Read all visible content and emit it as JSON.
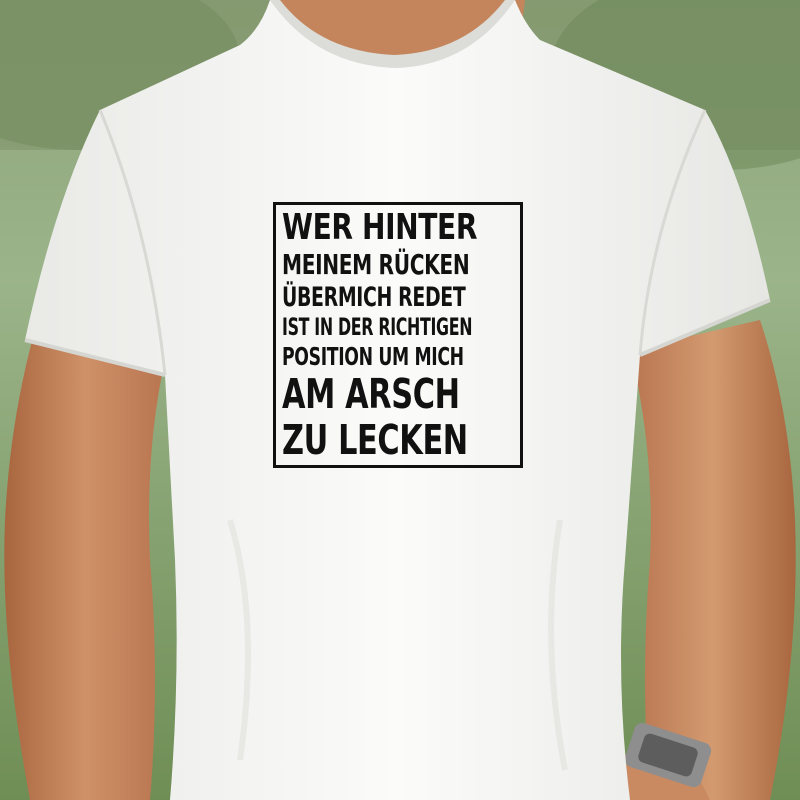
{
  "print": {
    "lines": [
      "WER HINTER",
      "MEINEM RÜCKEN",
      "ÜBERMICH REDET",
      "IST IN DER RICHTIGEN",
      "POSITION UM MICH",
      "AM ARSCH",
      "ZU LECKEN"
    ]
  },
  "colors": {
    "shirt": "#f7f7f5",
    "skin": "#c98a62",
    "grass": "#7f9a6a",
    "ink": "#111111"
  }
}
